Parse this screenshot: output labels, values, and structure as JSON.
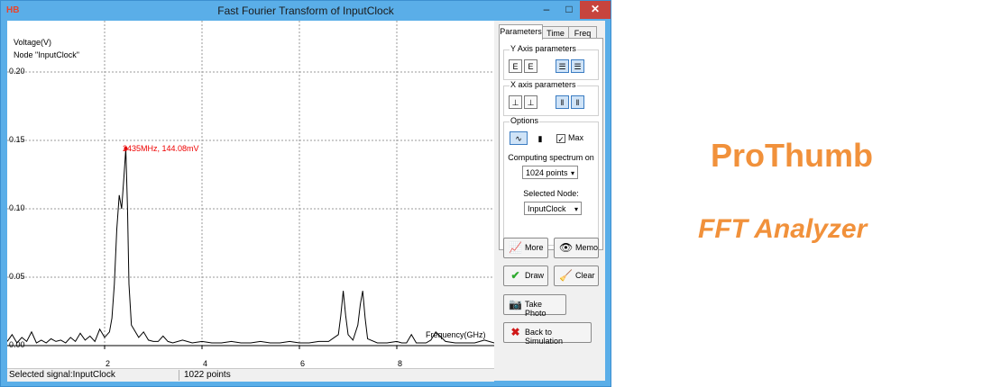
{
  "window": {
    "title": "Fast Fourier Transform of InputClock",
    "app_icon": "HB",
    "min_label": "–",
    "max_label": "□",
    "close_label": "✕"
  },
  "plot": {
    "y_axis_label": "Voltage(V)",
    "node_label": "Node \"InputClock\"",
    "x_axis_label": "Frequency(GHz)",
    "peak_label": "2435MHz, 144.08mV",
    "y_ticks": [
      "0.20",
      "0.15",
      "0.10",
      "0.05",
      "0.00"
    ],
    "x_ticks": [
      "2",
      "4",
      "6",
      "8"
    ]
  },
  "chart_data": {
    "type": "line",
    "xlabel": "Frequency(GHz)",
    "ylabel": "Voltage(V)",
    "xlim": [
      0,
      10
    ],
    "ylim": [
      0,
      0.2
    ],
    "grid": true,
    "annotations": [
      {
        "x": 2.435,
        "y": 0.14408,
        "text": "2435MHz, 144.08mV"
      }
    ],
    "series": [
      {
        "name": "InputClock",
        "x": [
          0.0,
          0.1,
          0.2,
          0.3,
          0.4,
          0.5,
          0.6,
          0.7,
          0.8,
          0.9,
          1.0,
          1.1,
          1.2,
          1.3,
          1.4,
          1.5,
          1.6,
          1.7,
          1.8,
          1.9,
          2.0,
          2.1,
          2.15,
          2.2,
          2.25,
          2.3,
          2.35,
          2.4,
          2.435,
          2.47,
          2.5,
          2.55,
          2.6,
          2.7,
          2.8,
          2.9,
          3.0,
          3.1,
          3.2,
          3.3,
          3.4,
          3.6,
          3.8,
          4.0,
          4.2,
          4.4,
          4.6,
          4.8,
          5.0,
          5.2,
          5.4,
          5.6,
          5.8,
          6.0,
          6.2,
          6.4,
          6.6,
          6.8,
          6.85,
          6.9,
          6.95,
          7.0,
          7.1,
          7.2,
          7.25,
          7.3,
          7.35,
          7.4,
          7.6,
          7.8,
          8.0,
          8.1,
          8.2,
          8.3,
          8.4,
          8.6,
          8.7,
          8.8,
          9.0,
          9.2,
          9.4,
          9.6,
          9.8,
          10.0
        ],
        "y": [
          0.003,
          0.008,
          0.002,
          0.006,
          0.003,
          0.01,
          0.002,
          0.004,
          0.002,
          0.005,
          0.003,
          0.004,
          0.002,
          0.006,
          0.003,
          0.009,
          0.004,
          0.007,
          0.003,
          0.012,
          0.006,
          0.01,
          0.02,
          0.045,
          0.085,
          0.11,
          0.1,
          0.125,
          0.144,
          0.1,
          0.045,
          0.015,
          0.012,
          0.006,
          0.01,
          0.004,
          0.003,
          0.003,
          0.007,
          0.003,
          0.002,
          0.004,
          0.002,
          0.003,
          0.002,
          0.002,
          0.003,
          0.002,
          0.002,
          0.003,
          0.002,
          0.002,
          0.003,
          0.002,
          0.002,
          0.003,
          0.003,
          0.008,
          0.022,
          0.04,
          0.022,
          0.008,
          0.004,
          0.015,
          0.03,
          0.04,
          0.02,
          0.005,
          0.002,
          0.002,
          0.003,
          0.002,
          0.002,
          0.008,
          0.002,
          0.002,
          0.004,
          0.01,
          0.003,
          0.002,
          0.002,
          0.002,
          0.004,
          0.002
        ]
      }
    ]
  },
  "status": {
    "signal": "Selected signal:InputClock",
    "points": "1022 points"
  },
  "panel": {
    "tabs": [
      "Parameters",
      "Time",
      "Freq"
    ],
    "y_group_label": "Y Axis parameters",
    "x_group_label": "X axis parameters",
    "options_label": "Options",
    "max_label": "Max",
    "max_checked": true,
    "computing_label": "Computing spectrum on",
    "points_select": "1024 points",
    "selected_node_label": "Selected Node:",
    "node_select": "InputClock"
  },
  "buttons": {
    "more": "More",
    "memo": "Memo",
    "draw": "Draw",
    "clear": "Clear",
    "take_photo": "Take Photo",
    "back": "Back to Simulation"
  },
  "brand": {
    "name": "ProThumb",
    "product": "FFT Analyzer"
  },
  "colors": {
    "window_frame": "#5aaee8",
    "close_button": "#c7443d",
    "peak_marker": "#e00000",
    "brand": "#f1913b",
    "draw_icon": "#2eaa2e",
    "back_icon": "#d01818"
  }
}
